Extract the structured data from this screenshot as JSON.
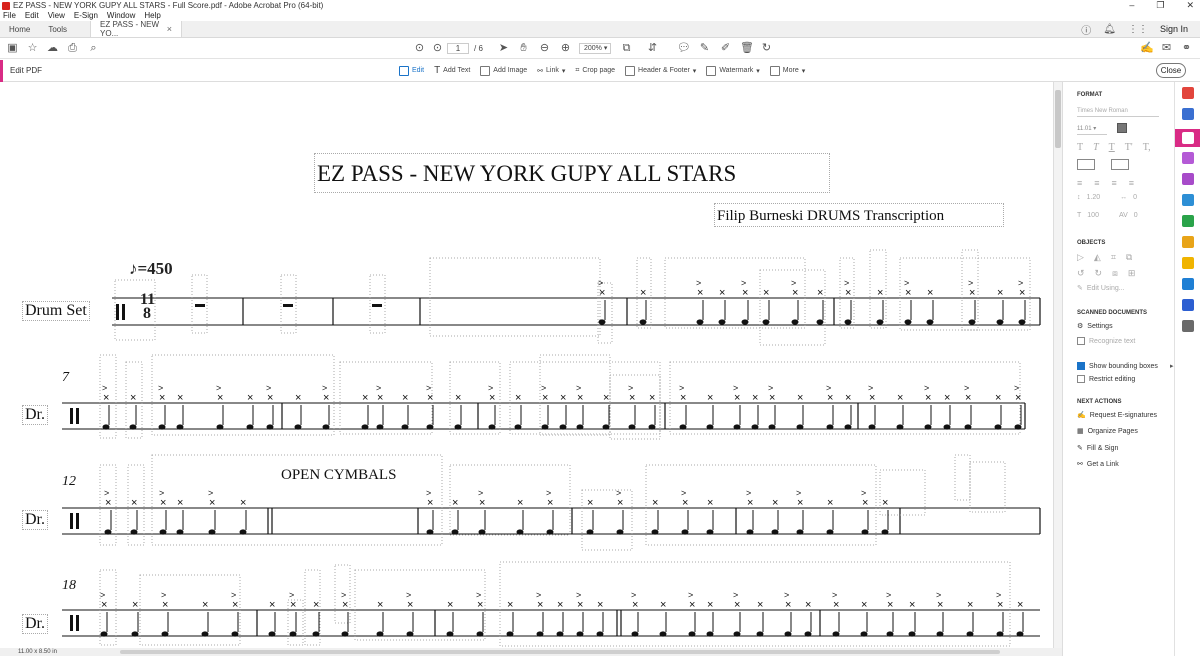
{
  "window": {
    "title": "EZ PASS - NEW YORK GUPY ALL STARS - Full Score.pdf - Adobe Acrobat Pro (64-bit)"
  },
  "menu": [
    "File",
    "Edit",
    "View",
    "E-Sign",
    "Window",
    "Help"
  ],
  "tabs": {
    "home": "Home",
    "tools": "Tools",
    "doc": "EZ PASS - NEW YO...",
    "signin": "Sign In"
  },
  "toolbar": {
    "page_current": "1",
    "page_total": "/ 6",
    "zoom": "200%"
  },
  "editbar": {
    "label": "Edit PDF",
    "tools": [
      "Edit",
      "Add Text",
      "Add Image",
      "Link",
      "Crop page",
      "Header & Footer",
      "Watermark",
      "More"
    ],
    "close": "Close"
  },
  "panel": {
    "format": "FORMAT",
    "font": "Times New Roman",
    "size": "11.01",
    "line_spacing": "1.20",
    "char_spacing": "0",
    "scale": "100",
    "kerning": "0",
    "objects": "OBJECTS",
    "edit_using": "Edit Using...",
    "scanned": "SCANNED DOCUMENTS",
    "settings": "Settings",
    "recognize": "Recognize text",
    "show_bbox": "Show bounding boxes",
    "restrict": "Restrict editing",
    "next": "NEXT ACTIONS",
    "actions": [
      "Request E-signatures",
      "Organize Pages",
      "Fill & Sign",
      "Get a Link"
    ]
  },
  "score": {
    "title": "EZ PASS - NEW YORK GUPY ALL STARS",
    "subtitle": "Filip Burneski DRUMS Transcription",
    "tempo": "=450",
    "instrument_full": "Drum Set",
    "instrument_short": "Dr.",
    "time_sig_top": "11",
    "time_sig_bottom": "8",
    "measure_numbers": [
      "7",
      "12",
      "18"
    ],
    "open_cymbals": "OPEN CYMBALS"
  },
  "status": {
    "page_size": "11.00 x 8.50 in"
  },
  "colors": {
    "accent": "#d92b85",
    "blue": "#1a73c8",
    "acrobat_red": "#d8231d"
  }
}
